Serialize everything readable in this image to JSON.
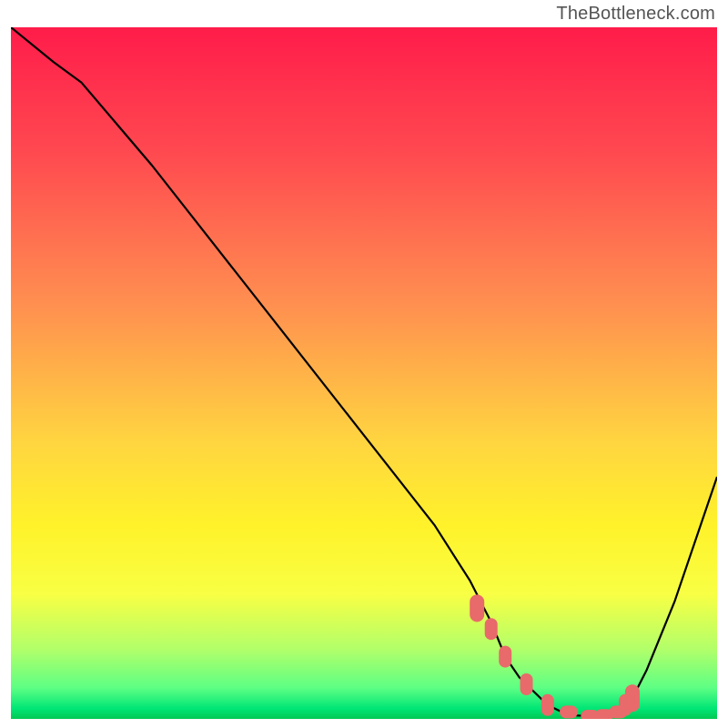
{
  "watermark": "TheBottleneck.com",
  "chart_data": {
    "type": "line",
    "title": "",
    "xlabel": "",
    "ylabel": "",
    "xlim": [
      0,
      100
    ],
    "ylim": [
      0,
      100
    ],
    "series": [
      {
        "name": "curve",
        "x": [
          0,
          6,
          10,
          20,
          30,
          40,
          50,
          60,
          65,
          68,
          70,
          72,
          74,
          76,
          78,
          80,
          82,
          84,
          86,
          88,
          90,
          94,
          100
        ],
        "values": [
          100,
          95,
          92,
          80,
          67,
          54,
          41,
          28,
          20,
          14,
          9,
          6,
          4,
          2,
          1,
          0.5,
          0.4,
          0.5,
          1,
          3,
          7,
          17,
          35
        ]
      }
    ],
    "markers": {
      "name": "highlight",
      "x": [
        66,
        68,
        70,
        73,
        76,
        79,
        82,
        84,
        86,
        87,
        88
      ],
      "values": [
        16,
        13,
        9,
        5,
        2,
        1,
        0.4,
        0.5,
        1,
        2,
        3
      ]
    },
    "gradient_stops": [
      {
        "offset": 0.0,
        "color": "#ff1c4a"
      },
      {
        "offset": 0.18,
        "color": "#ff4950"
      },
      {
        "offset": 0.4,
        "color": "#ff8f50"
      },
      {
        "offset": 0.6,
        "color": "#ffd540"
      },
      {
        "offset": 0.72,
        "color": "#fff22a"
      },
      {
        "offset": 0.82,
        "color": "#f8ff44"
      },
      {
        "offset": 0.9,
        "color": "#b1ff6a"
      },
      {
        "offset": 0.955,
        "color": "#5eff84"
      },
      {
        "offset": 0.985,
        "color": "#00e676"
      },
      {
        "offset": 1.0,
        "color": "#00c853"
      }
    ],
    "marker_color": "#e86a6a",
    "curve_color": "#000000"
  }
}
